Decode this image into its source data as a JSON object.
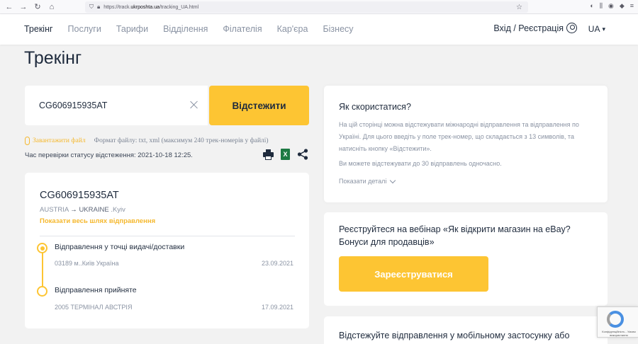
{
  "browser": {
    "url_prefix": "https://track.",
    "url_domain": "ukrposhta.ua",
    "url_suffix": "/tracking_UA.html"
  },
  "header": {
    "nav": [
      "Трекінг",
      "Послуги",
      "Тарифи",
      "Відділення",
      "Філателія",
      "Кар'єра",
      "Бізнесу"
    ],
    "login_label": "Вхід / Реєстрація",
    "lang_label": "UA"
  },
  "page": {
    "title": "Трекінг"
  },
  "search": {
    "value": "CG606915935AT",
    "track_button": "Відстежити",
    "upload_link": "Завантажити файл",
    "format_text": "Формат файлу: txt, xml (максимум 240 трек-номерів у файлі)",
    "check_time": "Час перевірки статусу відстеження: 2021-10-18 12:25.",
    "excel_letter": "X"
  },
  "shipment": {
    "number": "CG606915935AT",
    "origin": "AUSTRIA",
    "arrow": "→",
    "destination": "UKRAINE",
    "city": ".Kyiv",
    "show_path": "Показати весь шлях відправлення",
    "events": [
      {
        "title": "Відправлення у точці видачі/доставки",
        "place": "03189 м..Київ Україна",
        "date": "23.09.2021"
      },
      {
        "title": "Відправлення прийняте",
        "place": "2005 ТЕРМІНАЛ АВСТРІЯ",
        "date": "17.09.2021"
      }
    ]
  },
  "info": {
    "title": "Як скористатися?",
    "text": "На цій сторінці можна відстежувати міжнародні відправлення та відправлення по Україні. Для цього введіть у поле трек-номер, що складається з 13 символів, та натисніть кнопку «Відстежити».",
    "text2": "Ви можете відстежувати до 30 відправлень одночасно.",
    "details": "Показати деталі"
  },
  "webinar": {
    "title": "Реєструйтеся на вебінар «Як відкрити магазин на eBay? Бонуси для продавців»",
    "button": "Зареєструватися"
  },
  "mobile": {
    "title": "Відстежуйте відправлення у мобільному застосунку або"
  },
  "recaptcha": {
    "text": "Конфіденційність - Умови використання"
  }
}
